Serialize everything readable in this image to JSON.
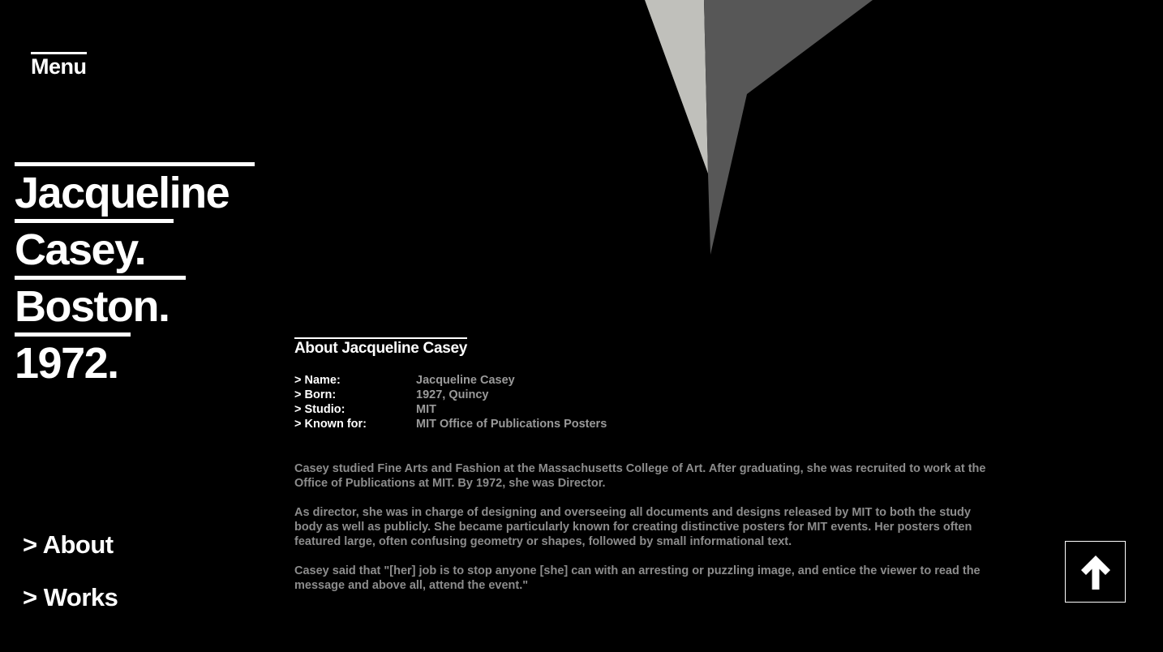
{
  "header": {
    "menu_label": "Menu"
  },
  "hero": {
    "lines": [
      "Jacqueline",
      "Casey.",
      "Boston.",
      "1972."
    ]
  },
  "nav": {
    "items": [
      {
        "label": "> About"
      },
      {
        "label": "> Works"
      }
    ]
  },
  "about": {
    "title": "About Jacqueline Casey",
    "facts": [
      {
        "label": "> Name:",
        "value": "Jacqueline Casey"
      },
      {
        "label": "> Born:",
        "value": "1927, Quincy"
      },
      {
        "label": "> Studio:",
        "value": "MIT"
      },
      {
        "label": "> Known for:",
        "value": "MIT Office of Publications Posters"
      }
    ],
    "paragraphs": [
      "Casey studied Fine Arts and Fashion at the Massachusetts College of Art. After graduating, she was recruited to work at the Office of Publications at MIT. By 1972, she was Director.",
      "As director, she was in charge of designing and overseeing all documents and designs released by MIT to both the study body as well as publicly. She became particularly known for creating distinctive posters for MIT events. Her posters often featured large, often confusing geometry or shapes, followed by small informational text.",
      "Casey said that \"[her] job is to stop anyone [she] can with an arresting or puzzling image, and entice the viewer to read the message and above all, attend the event.\""
    ]
  },
  "colors": {
    "background": "#000000",
    "text": "#ffffff",
    "muted_text": "#8c8c8c",
    "shape_light": "#c0c0bb",
    "shape_dark": "#575757"
  },
  "icons": {
    "scroll_top": "arrow-up-icon"
  }
}
